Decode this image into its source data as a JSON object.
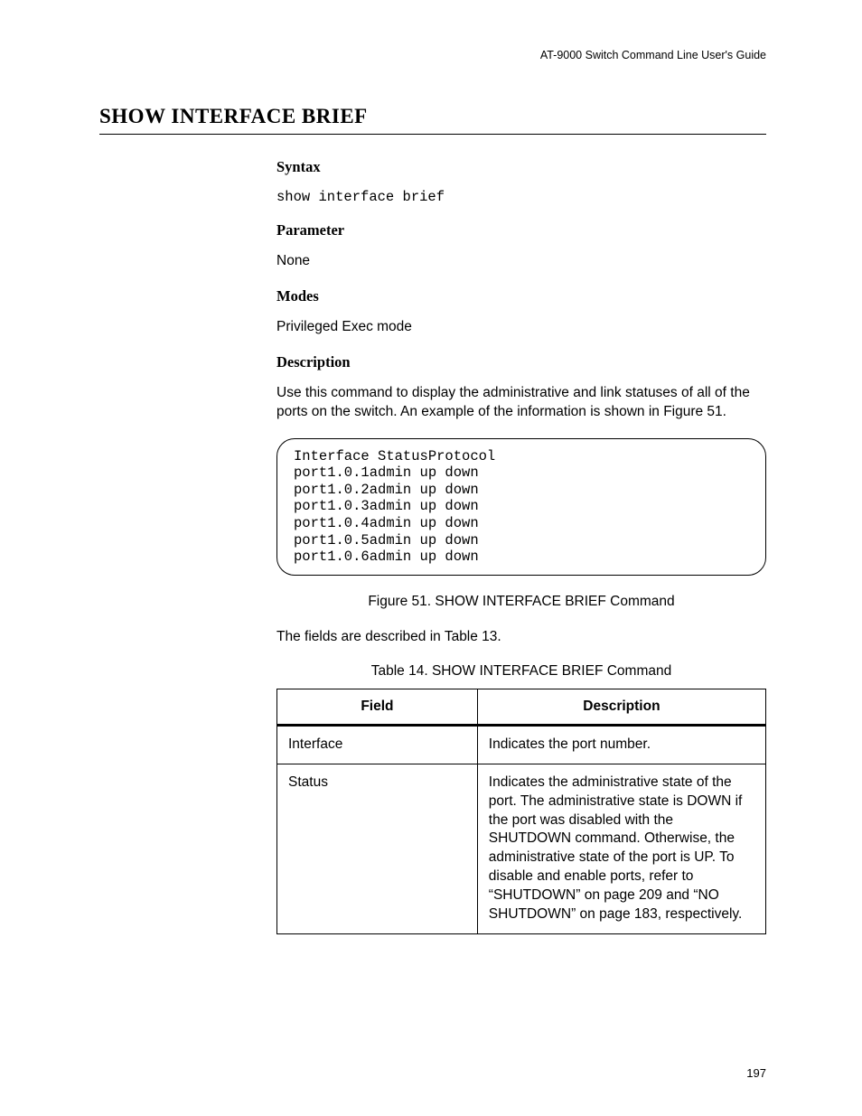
{
  "header": "AT-9000 Switch Command Line User's Guide",
  "title": "SHOW INTERFACE BRIEF",
  "sections": {
    "syntax": {
      "heading": "Syntax",
      "command": "show interface brief"
    },
    "parameter": {
      "heading": "Parameter",
      "text": "None"
    },
    "modes": {
      "heading": "Modes",
      "text": "Privileged Exec mode"
    },
    "description": {
      "heading": "Description",
      "text": "Use this command to display the administrative and link statuses of all of the ports on the switch. An example of the information is shown in Figure 51."
    }
  },
  "output": "Interface StatusProtocol\nport1.0.1admin up down\nport1.0.2admin up down\nport1.0.3admin up down\nport1.0.4admin up down\nport1.0.5admin up down\nport1.0.6admin up down",
  "figureCaption": "Figure 51. SHOW INTERFACE BRIEF Command",
  "afterFigure": "The fields are described in Table 13.",
  "tableCaption": "Table 14. SHOW INTERFACE BRIEF Command",
  "table": {
    "headers": {
      "field": "Field",
      "description": "Description"
    },
    "rows": [
      {
        "field": "Interface",
        "description": "Indicates the port number."
      },
      {
        "field": "Status",
        "description": "Indicates the administrative state of the port. The administrative state is DOWN if the port was disabled with the SHUTDOWN command. Otherwise, the administrative state of the port is UP. To disable and enable ports, refer to “SHUTDOWN” on page 209 and “NO SHUTDOWN” on page 183, respectively."
      }
    ]
  },
  "pageNumber": "197"
}
